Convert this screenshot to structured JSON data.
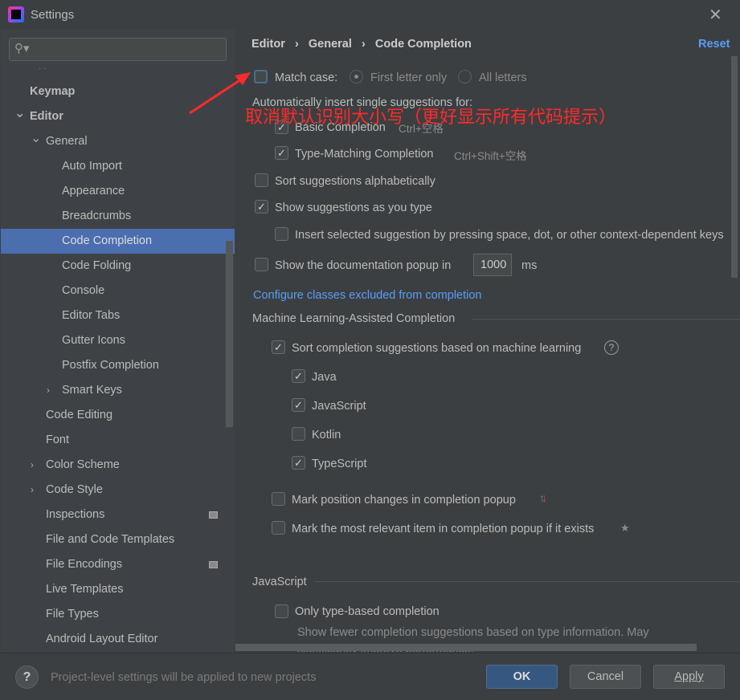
{
  "window": {
    "title": "Settings",
    "close_icon": "close-icon"
  },
  "search": {
    "placeholder": ""
  },
  "sidebar": {
    "items": [
      {
        "label": "Keymap",
        "level": 0,
        "bold": true
      },
      {
        "label": "Editor",
        "level": 0,
        "bold": true,
        "expanded": true
      },
      {
        "label": "General",
        "level": 1,
        "expanded": true
      },
      {
        "label": "Auto Import",
        "level": 2
      },
      {
        "label": "Appearance",
        "level": 2
      },
      {
        "label": "Breadcrumbs",
        "level": 2
      },
      {
        "label": "Code Completion",
        "level": 2,
        "selected": true
      },
      {
        "label": "Code Folding",
        "level": 2
      },
      {
        "label": "Console",
        "level": 2
      },
      {
        "label": "Editor Tabs",
        "level": 2
      },
      {
        "label": "Gutter Icons",
        "level": 2
      },
      {
        "label": "Postfix Completion",
        "level": 2
      },
      {
        "label": "Smart Keys",
        "level": 2,
        "expanded": false
      },
      {
        "label": "Code Editing",
        "level": 1
      },
      {
        "label": "Font",
        "level": 1
      },
      {
        "label": "Color Scheme",
        "level": 1,
        "expanded": false
      },
      {
        "label": "Code Style",
        "level": 1,
        "expanded": false
      },
      {
        "label": "Inspections",
        "level": 1,
        "project_icon": true
      },
      {
        "label": "File and Code Templates",
        "level": 1
      },
      {
        "label": "File Encodings",
        "level": 1,
        "project_icon": true
      },
      {
        "label": "Live Templates",
        "level": 1
      },
      {
        "label": "File Types",
        "level": 1
      },
      {
        "label": "Android Layout Editor",
        "level": 1
      }
    ]
  },
  "breadcrumb": [
    "Editor",
    "General",
    "Code Completion"
  ],
  "reset": "Reset",
  "match_case": {
    "label": "Match case:",
    "checked": false,
    "options": [
      "First letter only",
      "All letters"
    ],
    "selected": "First letter only"
  },
  "auto_insert": {
    "label": "Automatically insert single suggestions for:",
    "items": [
      {
        "label": "Basic Completion",
        "shortcut": "Ctrl+空格",
        "checked": true
      },
      {
        "label": "Type-Matching Completion",
        "shortcut": "Ctrl+Shift+空格",
        "checked": true
      }
    ]
  },
  "sort_alpha": {
    "label": "Sort suggestions alphabetically",
    "checked": false
  },
  "show_as_type": {
    "label": "Show suggestions as you type",
    "checked": true
  },
  "insert_selected": {
    "label": "Insert selected suggestion by pressing space, dot, or other context-dependent keys",
    "checked": false
  },
  "doc_popup": {
    "label": "Show the documentation popup in",
    "value": "1000",
    "unit": "ms",
    "checked": false
  },
  "configure_link": "Configure classes excluded from completion",
  "ml": {
    "title": "Machine Learning-Assisted Completion",
    "sort": {
      "label": "Sort completion suggestions based on machine learning",
      "checked": true
    },
    "languages": [
      {
        "label": "Java",
        "checked": true
      },
      {
        "label": "JavaScript",
        "checked": true
      },
      {
        "label": "Kotlin",
        "checked": false
      },
      {
        "label": "TypeScript",
        "checked": true
      }
    ],
    "mark_position": {
      "label": "Mark position changes in completion popup",
      "checked": false
    },
    "mark_relevant": {
      "label": "Mark the most relevant item in completion popup if it exists",
      "checked": false
    }
  },
  "javascript": {
    "title": "JavaScript",
    "only_type": {
      "label": "Only type-based completion",
      "checked": false
    },
    "description": "Show fewer completion suggestions based on type information. May significantly improve performance."
  },
  "footer": {
    "help": "?",
    "note": "Project-level settings will be applied to new projects",
    "ok": "OK",
    "cancel": "Cancel",
    "apply": "Apply"
  },
  "annotation": {
    "text": "取消默认识别大小写（更好显示所有代码提示）",
    "color": "#ff2a2a"
  }
}
